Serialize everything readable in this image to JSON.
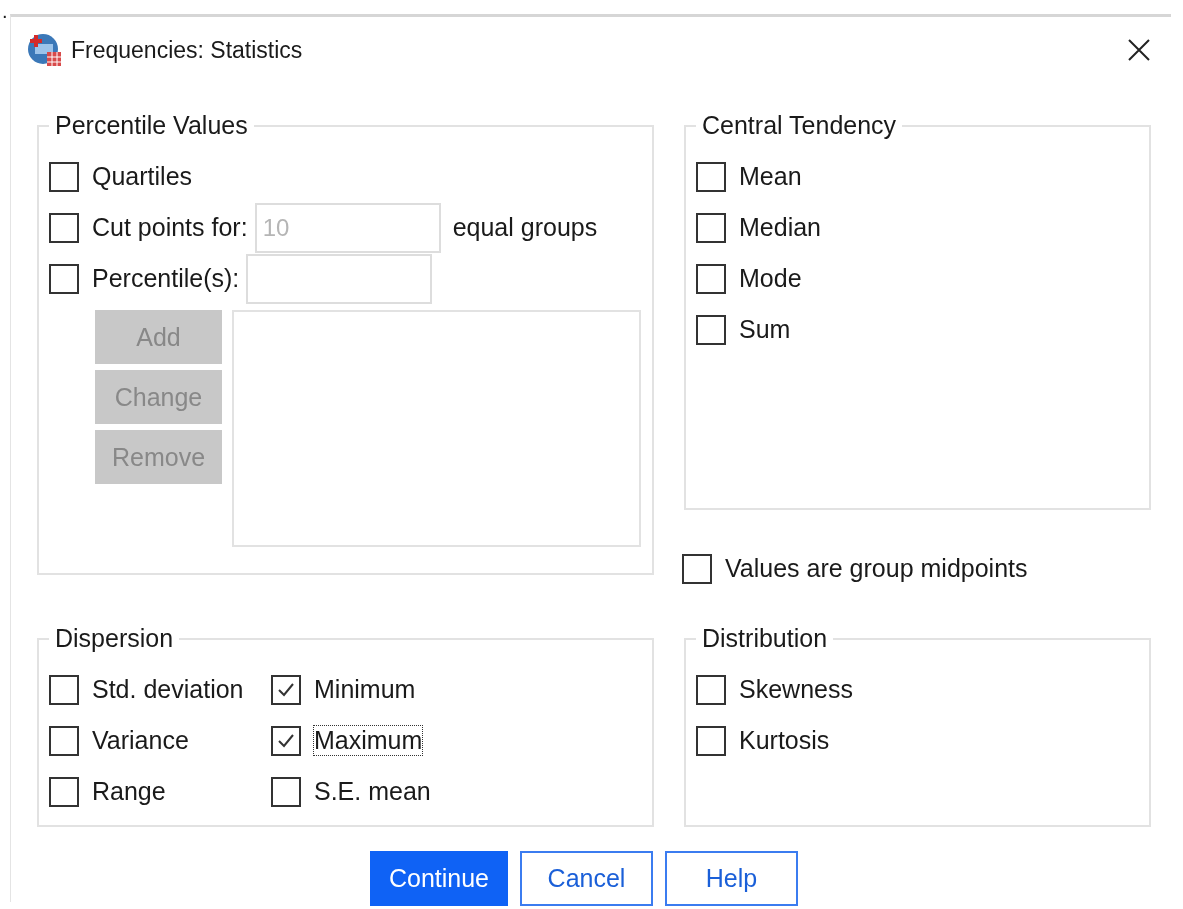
{
  "corner_mark": ".",
  "window": {
    "title": "Frequencies: Statistics"
  },
  "percentile_values": {
    "title": "Percentile Values",
    "options": [
      {
        "kind": "checkbox",
        "label": "Quartiles",
        "checked": false
      },
      {
        "kind": "cut_points",
        "label": "Cut points for:",
        "checked": false,
        "value": "10",
        "disabled": true,
        "suffix": "equal groups"
      },
      {
        "kind": "percentiles",
        "label": "Percentile(s):",
        "checked": false
      }
    ],
    "buttons": [
      {
        "label": "Add",
        "disabled": true
      },
      {
        "label": "Change",
        "disabled": true
      },
      {
        "label": "Remove",
        "disabled": true
      }
    ]
  },
  "central_tendency": {
    "title": "Central Tendency",
    "options": [
      {
        "label": "Mean",
        "checked": false
      },
      {
        "label": "Median",
        "checked": false
      },
      {
        "label": "Mode",
        "checked": false
      },
      {
        "label": "Sum",
        "checked": false
      }
    ]
  },
  "values_group_midpoints": {
    "label": "Values are group midpoints",
    "checked": false
  },
  "dispersion": {
    "title": "Dispersion",
    "options": [
      {
        "label": "Std. deviation",
        "checked": false,
        "focused": false
      },
      {
        "label": "Minimum",
        "checked": true,
        "focused": false
      },
      {
        "label": "Variance",
        "checked": false,
        "focused": false
      },
      {
        "label": "Maximum",
        "checked": true,
        "focused": true
      },
      {
        "label": "Range",
        "checked": false,
        "focused": false
      },
      {
        "label": "S.E. mean",
        "checked": false,
        "focused": false
      }
    ]
  },
  "distribution": {
    "title": "Distribution",
    "options": [
      {
        "label": "Skewness",
        "checked": false
      },
      {
        "label": "Kurtosis",
        "checked": false
      }
    ]
  },
  "buttons": [
    {
      "label": "Continue",
      "default": true
    },
    {
      "label": "Cancel",
      "default": false
    },
    {
      "label": "Help",
      "default": false
    }
  ]
}
